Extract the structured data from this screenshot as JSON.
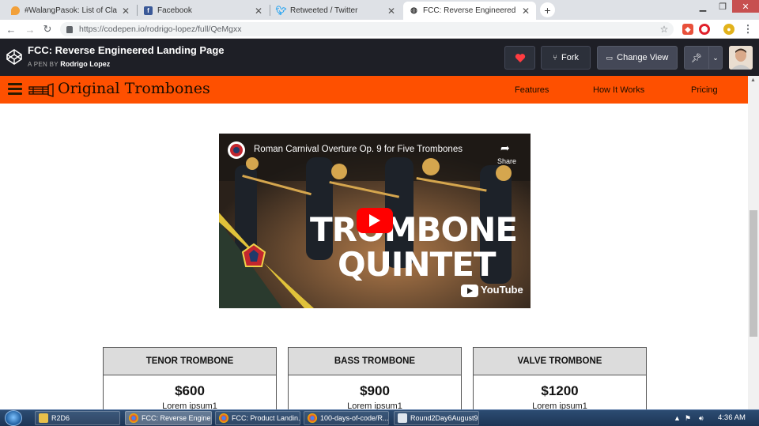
{
  "browser": {
    "tabs": [
      {
        "title": "#WalangPasok: List of Class susp",
        "favicon": "pin-icon"
      },
      {
        "title": "Facebook",
        "favicon": "facebook-icon"
      },
      {
        "title": "Retweeted / Twitter",
        "favicon": "twitter-icon"
      },
      {
        "title": "FCC: Reverse Engineered Landing",
        "favicon": "codepen-icon",
        "active": true
      }
    ],
    "url": "https://codepen.io/rodrigo-lopez/full/QeMgxx"
  },
  "codepen": {
    "title": "FCC: Reverse Engineered Landing Page",
    "sub_prefix": "A PEN BY",
    "author": "Rodrigo Lopez",
    "fork_label": "Fork",
    "change_view_label": "Change View"
  },
  "site": {
    "brand": "Original Trombones",
    "nav": [
      "Features",
      "How It Works",
      "Pricing"
    ]
  },
  "video": {
    "title": "Roman Carnival Overture Op. 9 for Five Trombones",
    "share_label": "Share",
    "line1": "TROMBONE",
    "line2": "QUINTET",
    "provider": "YouTube"
  },
  "pricing": [
    {
      "name": "TENOR TROMBONE",
      "price": "$600",
      "desc": "Lorem ipsum1"
    },
    {
      "name": "BASS TROMBONE",
      "price": "$900",
      "desc": "Lorem ipsum1"
    },
    {
      "name": "VALVE TROMBONE",
      "price": "$1200",
      "desc": "Lorem ipsum1"
    }
  ],
  "taskbar": {
    "items": [
      "R2D6",
      "FCC: Reverse Engine...",
      "FCC: Product Landin...",
      "100-days-of-code/R...",
      "Round2Day6August9..."
    ],
    "time": "4:36 AM"
  },
  "colors": {
    "orange": "#fe5000",
    "codepen_bg": "#1e1f26",
    "youtube_red": "#ff0000"
  }
}
